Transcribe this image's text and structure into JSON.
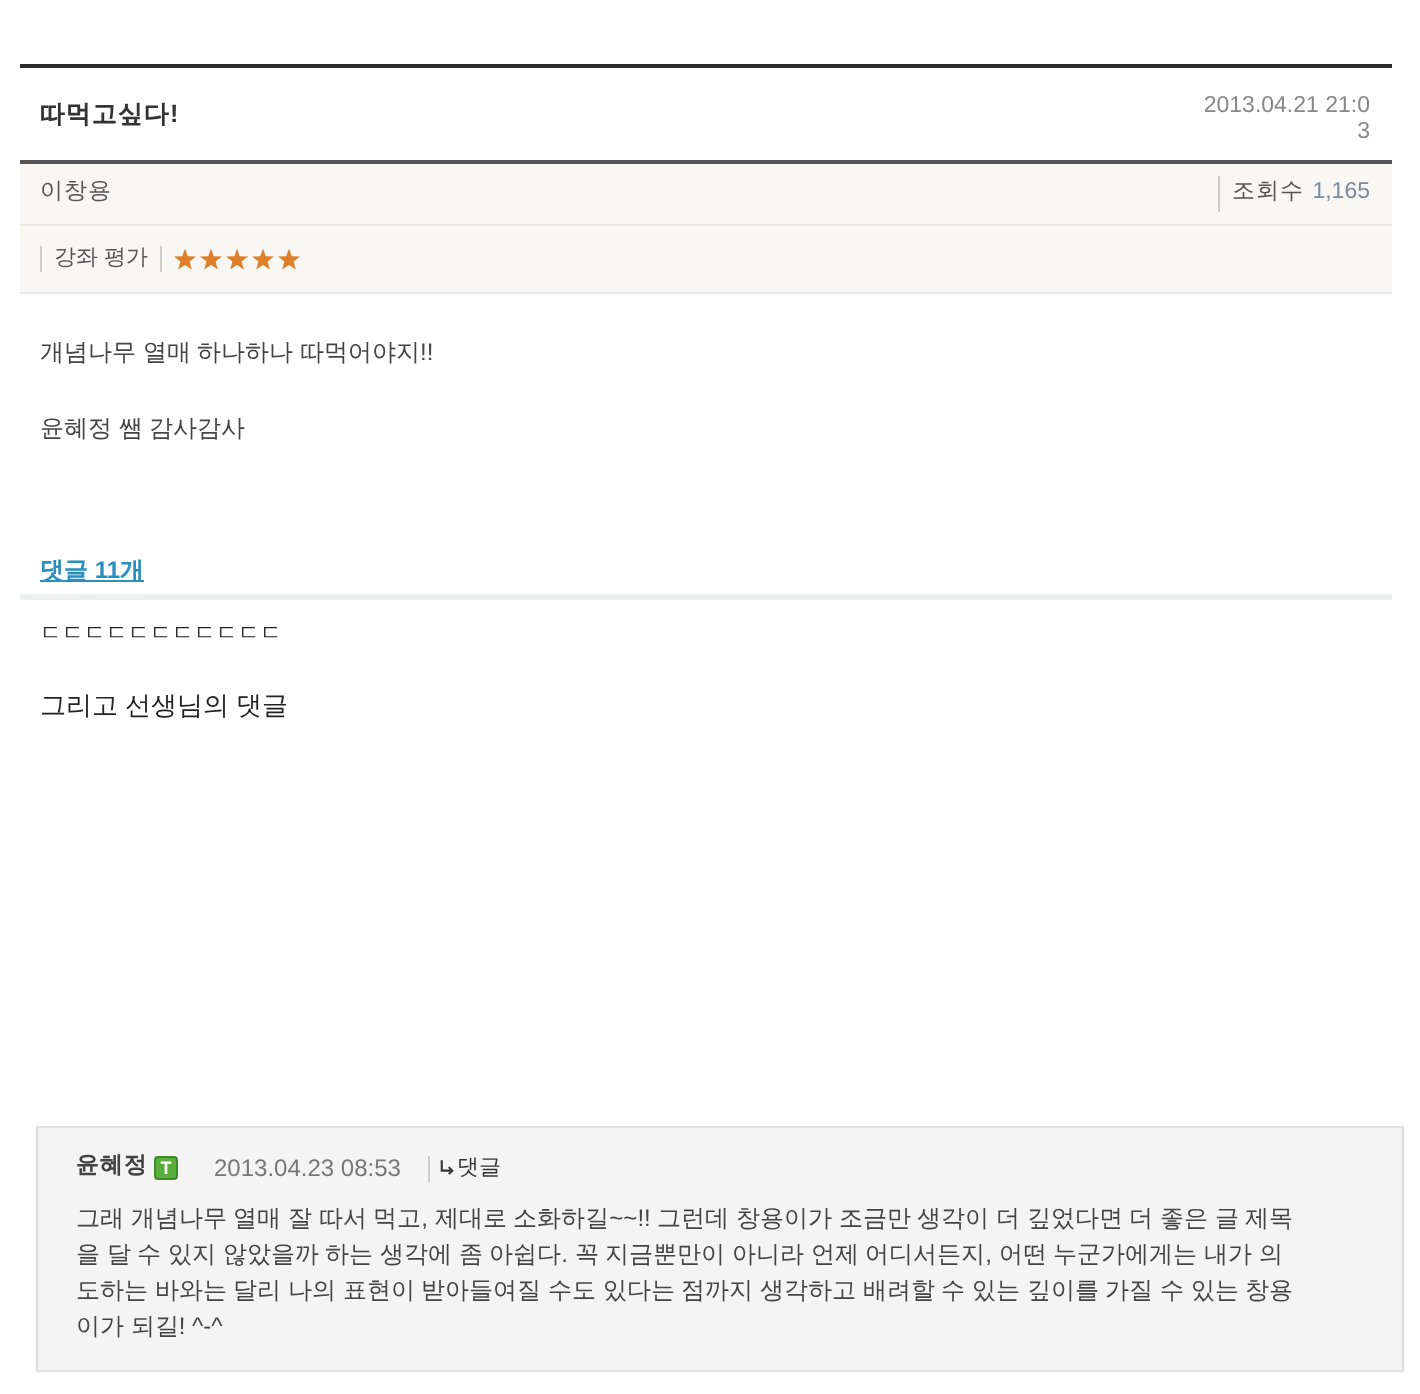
{
  "post": {
    "title": "따먹고싶다!",
    "date": "2013.04.21 21:03",
    "author": "이창용",
    "views_label": "조회수",
    "views": "1,165",
    "rating_label": "강좌 평가",
    "stars": 5
  },
  "body": {
    "paragraphs": [
      "개념나무 열매 하나하나 따먹어야지!!",
      "윤혜정 쌤 감사감사"
    ]
  },
  "comments_link": "댓글 11개",
  "comment_preview": "ㄷㄷㄷㄷㄷㄷㄷㄷㄷㄷㄷ",
  "caption": "그리고 선생님의 댓글",
  "reply": {
    "author": "윤혜정",
    "badge": "T",
    "date": "2013.04.23 08:53",
    "reply_link": "댓글",
    "text": "그래 개념나무 열매 잘 따서 먹고, 제대로 소화하길~~!! 그런데 창용이가 조금만 생각이 더 깊었다면 더 좋은 글 제목을 달 수 있지 않았을까 하는 생각에 좀 아쉽다. 꼭 지금뿐만이 아니라 언제 어디서든지, 어떤 누군가에게는 내가 의도하는 바와는 달리 나의 표현이 받아들여질 수도 있다는 점까지 생각하고 배려할 수 있는 깊이를 가질 수 있는 창용이가 되길! ^-^"
  }
}
